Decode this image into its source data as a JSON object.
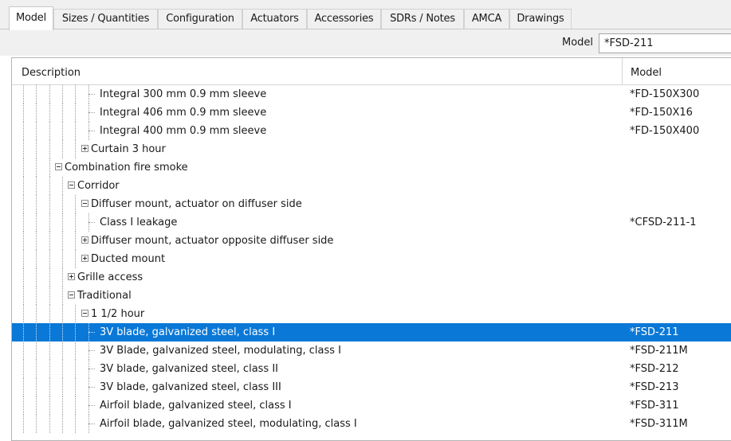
{
  "tabs": [
    {
      "label": "Model"
    },
    {
      "label": "Sizes / Quantities"
    },
    {
      "label": "Configuration"
    },
    {
      "label": "Actuators"
    },
    {
      "label": "Accessories"
    },
    {
      "label": "SDRs / Notes"
    },
    {
      "label": "AMCA"
    },
    {
      "label": "Drawings"
    }
  ],
  "model_field": {
    "label": "Model",
    "value": "*FSD-211"
  },
  "grid": {
    "columns": {
      "description": "Description",
      "model": "Model"
    },
    "rows": [
      {
        "text": "Integral 300 mm 0.9 mm sleeve",
        "model": "*FD-150X300"
      },
      {
        "text": "Integral 406 mm 0.9 mm sleeve",
        "model": "*FD-150X16"
      },
      {
        "text": "Integral 400 mm 0.9 mm sleeve",
        "model": "*FD-150X400"
      },
      {
        "text": "Curtain 3 hour",
        "model": ""
      },
      {
        "text": "Combination fire smoke",
        "model": ""
      },
      {
        "text": "Corridor",
        "model": ""
      },
      {
        "text": "Diffuser mount, actuator on diffuser side",
        "model": ""
      },
      {
        "text": "Class I leakage",
        "model": "*CFSD-211-1"
      },
      {
        "text": "Diffuser mount, actuator opposite diffuser side",
        "model": ""
      },
      {
        "text": "Ducted mount",
        "model": ""
      },
      {
        "text": "Grille access",
        "model": ""
      },
      {
        "text": "Traditional",
        "model": ""
      },
      {
        "text": "1 1/2 hour",
        "model": ""
      },
      {
        "text": "3V blade, galvanized steel, class I",
        "model": "*FSD-211"
      },
      {
        "text": "3V Blade, galvanized steel, modulating, class I",
        "model": "*FSD-211M"
      },
      {
        "text": "3V blade, galvanized steel, class II",
        "model": "*FSD-212"
      },
      {
        "text": "3V blade, galvanized steel, class III",
        "model": "*FSD-213"
      },
      {
        "text": "Airfoil blade, galvanized steel, class I",
        "model": "*FSD-311"
      },
      {
        "text": "Airfoil blade, galvanized steel, modulating, class I",
        "model": "*FSD-311M"
      }
    ]
  },
  "colors": {
    "selection": "#0a78d7",
    "tab_bg": "#f0f0f0"
  }
}
